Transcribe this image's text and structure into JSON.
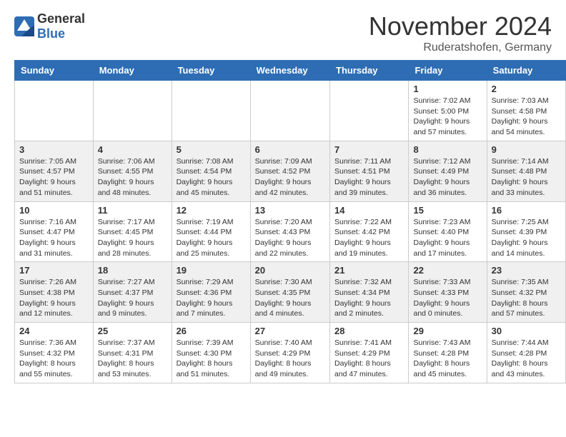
{
  "header": {
    "logo_general": "General",
    "logo_blue": "Blue",
    "month_title": "November 2024",
    "subtitle": "Ruderatshofen, Germany"
  },
  "days_of_week": [
    "Sunday",
    "Monday",
    "Tuesday",
    "Wednesday",
    "Thursday",
    "Friday",
    "Saturday"
  ],
  "weeks": [
    [
      {
        "day": "",
        "info": ""
      },
      {
        "day": "",
        "info": ""
      },
      {
        "day": "",
        "info": ""
      },
      {
        "day": "",
        "info": ""
      },
      {
        "day": "",
        "info": ""
      },
      {
        "day": "1",
        "info": "Sunrise: 7:02 AM\nSunset: 5:00 PM\nDaylight: 9 hours and 57 minutes."
      },
      {
        "day": "2",
        "info": "Sunrise: 7:03 AM\nSunset: 4:58 PM\nDaylight: 9 hours and 54 minutes."
      }
    ],
    [
      {
        "day": "3",
        "info": "Sunrise: 7:05 AM\nSunset: 4:57 PM\nDaylight: 9 hours and 51 minutes."
      },
      {
        "day": "4",
        "info": "Sunrise: 7:06 AM\nSunset: 4:55 PM\nDaylight: 9 hours and 48 minutes."
      },
      {
        "day": "5",
        "info": "Sunrise: 7:08 AM\nSunset: 4:54 PM\nDaylight: 9 hours and 45 minutes."
      },
      {
        "day": "6",
        "info": "Sunrise: 7:09 AM\nSunset: 4:52 PM\nDaylight: 9 hours and 42 minutes."
      },
      {
        "day": "7",
        "info": "Sunrise: 7:11 AM\nSunset: 4:51 PM\nDaylight: 9 hours and 39 minutes."
      },
      {
        "day": "8",
        "info": "Sunrise: 7:12 AM\nSunset: 4:49 PM\nDaylight: 9 hours and 36 minutes."
      },
      {
        "day": "9",
        "info": "Sunrise: 7:14 AM\nSunset: 4:48 PM\nDaylight: 9 hours and 33 minutes."
      }
    ],
    [
      {
        "day": "10",
        "info": "Sunrise: 7:16 AM\nSunset: 4:47 PM\nDaylight: 9 hours and 31 minutes."
      },
      {
        "day": "11",
        "info": "Sunrise: 7:17 AM\nSunset: 4:45 PM\nDaylight: 9 hours and 28 minutes."
      },
      {
        "day": "12",
        "info": "Sunrise: 7:19 AM\nSunset: 4:44 PM\nDaylight: 9 hours and 25 minutes."
      },
      {
        "day": "13",
        "info": "Sunrise: 7:20 AM\nSunset: 4:43 PM\nDaylight: 9 hours and 22 minutes."
      },
      {
        "day": "14",
        "info": "Sunrise: 7:22 AM\nSunset: 4:42 PM\nDaylight: 9 hours and 19 minutes."
      },
      {
        "day": "15",
        "info": "Sunrise: 7:23 AM\nSunset: 4:40 PM\nDaylight: 9 hours and 17 minutes."
      },
      {
        "day": "16",
        "info": "Sunrise: 7:25 AM\nSunset: 4:39 PM\nDaylight: 9 hours and 14 minutes."
      }
    ],
    [
      {
        "day": "17",
        "info": "Sunrise: 7:26 AM\nSunset: 4:38 PM\nDaylight: 9 hours and 12 minutes."
      },
      {
        "day": "18",
        "info": "Sunrise: 7:27 AM\nSunset: 4:37 PM\nDaylight: 9 hours and 9 minutes."
      },
      {
        "day": "19",
        "info": "Sunrise: 7:29 AM\nSunset: 4:36 PM\nDaylight: 9 hours and 7 minutes."
      },
      {
        "day": "20",
        "info": "Sunrise: 7:30 AM\nSunset: 4:35 PM\nDaylight: 9 hours and 4 minutes."
      },
      {
        "day": "21",
        "info": "Sunrise: 7:32 AM\nSunset: 4:34 PM\nDaylight: 9 hours and 2 minutes."
      },
      {
        "day": "22",
        "info": "Sunrise: 7:33 AM\nSunset: 4:33 PM\nDaylight: 9 hours and 0 minutes."
      },
      {
        "day": "23",
        "info": "Sunrise: 7:35 AM\nSunset: 4:32 PM\nDaylight: 8 hours and 57 minutes."
      }
    ],
    [
      {
        "day": "24",
        "info": "Sunrise: 7:36 AM\nSunset: 4:32 PM\nDaylight: 8 hours and 55 minutes."
      },
      {
        "day": "25",
        "info": "Sunrise: 7:37 AM\nSunset: 4:31 PM\nDaylight: 8 hours and 53 minutes."
      },
      {
        "day": "26",
        "info": "Sunrise: 7:39 AM\nSunset: 4:30 PM\nDaylight: 8 hours and 51 minutes."
      },
      {
        "day": "27",
        "info": "Sunrise: 7:40 AM\nSunset: 4:29 PM\nDaylight: 8 hours and 49 minutes."
      },
      {
        "day": "28",
        "info": "Sunrise: 7:41 AM\nSunset: 4:29 PM\nDaylight: 8 hours and 47 minutes."
      },
      {
        "day": "29",
        "info": "Sunrise: 7:43 AM\nSunset: 4:28 PM\nDaylight: 8 hours and 45 minutes."
      },
      {
        "day": "30",
        "info": "Sunrise: 7:44 AM\nSunset: 4:28 PM\nDaylight: 8 hours and 43 minutes."
      }
    ]
  ]
}
